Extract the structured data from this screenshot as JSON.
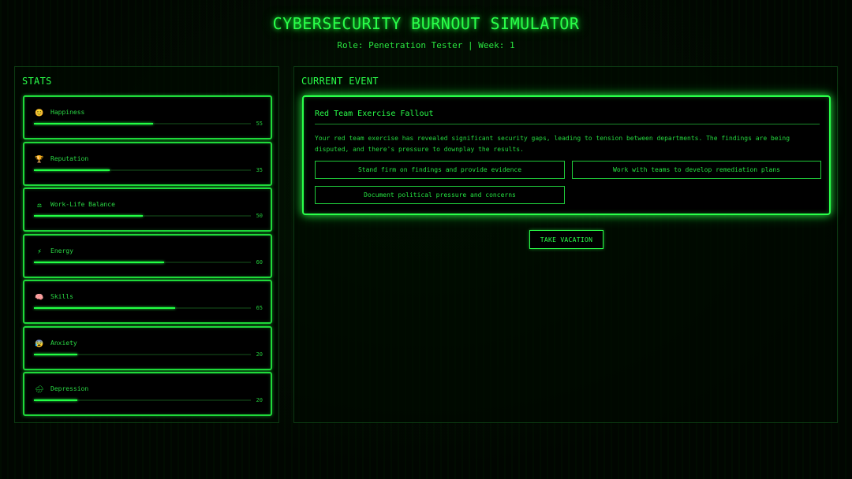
{
  "header": {
    "title": "CYBERSECURITY BURNOUT SIMULATOR",
    "subtitle": "Role: Penetration Tester | Week: 1"
  },
  "stats": {
    "heading": "STATS",
    "items": [
      {
        "label": "Happiness",
        "value": "55",
        "level": 55,
        "icon": "smiley-icon",
        "glyph": "😊"
      },
      {
        "label": "Reputation",
        "value": "35",
        "level": 35,
        "icon": "trophy-icon",
        "glyph": "🏆"
      },
      {
        "label": "Work-Life Balance",
        "value": "50",
        "level": 50,
        "icon": "scales-icon",
        "glyph": "⚖"
      },
      {
        "label": "Energy",
        "value": "60",
        "level": 60,
        "icon": "lightning-icon",
        "glyph": "⚡"
      },
      {
        "label": "Skills",
        "value": "65",
        "level": 65,
        "icon": "brain-icon",
        "glyph": "🧠"
      },
      {
        "label": "Anxiety",
        "value": "20",
        "level": 20,
        "icon": "anxious-face-icon",
        "glyph": "😰"
      },
      {
        "label": "Depression",
        "value": "20",
        "level": 20,
        "icon": "rain-cloud-icon",
        "glyph": "🌧"
      }
    ]
  },
  "event": {
    "heading": "CURRENT EVENT",
    "title": "Red Team Exercise Fallout",
    "description": "Your red team exercise has revealed significant security gaps, leading to tension between departments. The findings are being disputed, and there's pressure to downplay the results.",
    "choices": [
      "Stand firm on findings and provide evidence",
      "Work with teams to develop remediation plans",
      "Document political pressure and concerns"
    ]
  },
  "actions": {
    "vacation_label": "TAKE VACATION"
  },
  "colors": {
    "accent": "#22ff44",
    "background": "#010601"
  }
}
